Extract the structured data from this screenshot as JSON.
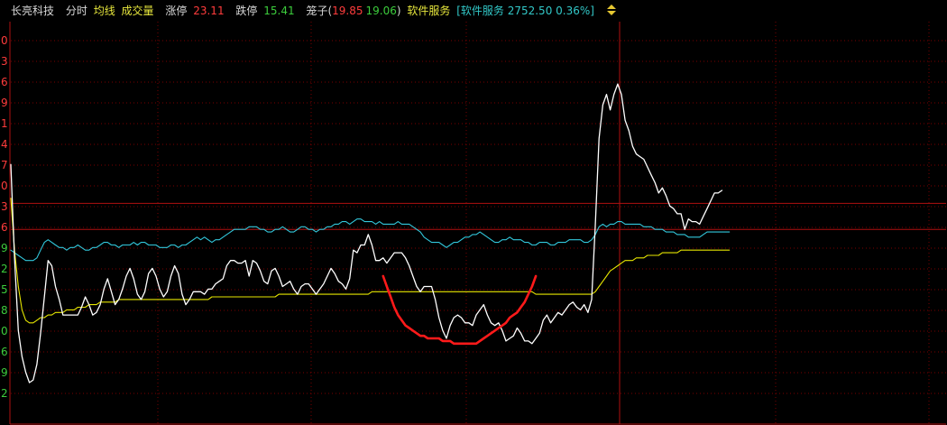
{
  "header": {
    "stock_name": "长亮科技",
    "mode_intraday": "分时",
    "mode_avg": "均线",
    "mode_volume": "成交量",
    "limit_up_label": "涨停",
    "limit_up_value": "23.11",
    "limit_down_label": "跌停",
    "limit_down_value": "15.41",
    "cage_label": "笼子(",
    "cage_high": "19.85",
    "cage_low": "19.06",
    "cage_close": ")",
    "sector": "软件服务",
    "index_text": "[软件服务 2752.50 0.36%]",
    "arrow_icon": "up-down-arrow-icon"
  },
  "colors": {
    "background": "#000000",
    "grid": "#7a0000",
    "stock_name": "#d8d8d8",
    "intraday": "#d8d8d8",
    "avg_label": "#e6e63c",
    "volume_label": "#e6e63c",
    "up": "#ff3c3c",
    "down": "#3ccc3c",
    "sector": "#e6e63c",
    "index": "#32c8c8",
    "price_line": "#ffffff",
    "avg_line": "#e6e600",
    "index_line": "#32c8dc",
    "marker_curve": "#ff1a1a",
    "arrow": "#e6c832"
  },
  "chart_data": {
    "type": "line",
    "y_axis_ticks": [
      "0",
      "3",
      "6",
      "9",
      "1",
      "4",
      "7",
      "0",
      "3",
      "6",
      "9",
      "2",
      "5",
      "8",
      "0",
      "6",
      "9",
      "2"
    ],
    "y_tick_colors": [
      "up",
      "up",
      "up",
      "up",
      "up",
      "up",
      "up",
      "up",
      "up",
      "up",
      "down",
      "down",
      "down",
      "down",
      "down",
      "down",
      "down",
      "down"
    ],
    "series": [
      {
        "key": "price",
        "values": [
          0.45,
          0.09,
          -0.19,
          -0.29,
          -0.35,
          -0.39,
          -0.38,
          -0.32,
          -0.2,
          -0.06,
          0.08,
          0.06,
          -0.02,
          -0.07,
          -0.13,
          -0.13,
          -0.13,
          -0.13,
          -0.13,
          -0.1,
          -0.06,
          -0.09,
          -0.13,
          -0.12,
          -0.09,
          -0.03,
          0.01,
          -0.04,
          -0.09,
          -0.07,
          -0.03,
          0.02,
          0.05,
          0.01,
          -0.05,
          -0.07,
          -0.04,
          0.03,
          0.05,
          0.02,
          -0.03,
          -0.06,
          -0.04,
          0.02,
          0.06,
          0.03,
          -0.05,
          -0.09,
          -0.07,
          -0.04,
          -0.04,
          -0.04,
          -0.05,
          -0.03,
          -0.03,
          -0.01,
          0.0,
          0.01,
          0.06,
          0.08,
          0.08,
          0.07,
          0.07,
          0.08,
          0.02,
          0.08,
          0.07,
          0.04,
          0.0,
          -0.01,
          0.04,
          0.05,
          0.02,
          -0.02,
          -0.01,
          0.0,
          -0.03,
          -0.05,
          -0.02,
          -0.01,
          -0.01,
          -0.03,
          -0.05,
          -0.03,
          -0.01,
          0.02,
          0.05,
          0.03,
          0.0,
          -0.01,
          -0.03,
          0.01,
          0.12,
          0.11,
          0.14,
          0.14,
          0.18,
          0.14,
          0.08,
          0.08,
          0.09,
          0.07,
          0.09,
          0.11,
          0.11,
          0.11,
          0.09,
          0.06,
          0.02,
          -0.02,
          -0.04,
          -0.02,
          -0.02,
          -0.02,
          -0.07,
          -0.14,
          -0.19,
          -0.22,
          -0.17,
          -0.14,
          -0.13,
          -0.14,
          -0.16,
          -0.16,
          -0.17,
          -0.13,
          -0.11,
          -0.09,
          -0.13,
          -0.16,
          -0.17,
          -0.16,
          -0.19,
          -0.23,
          -0.22,
          -0.21,
          -0.18,
          -0.2,
          -0.23,
          -0.23,
          -0.24,
          -0.22,
          -0.2,
          -0.15,
          -0.13,
          -0.16,
          -0.14,
          -0.12,
          -0.13,
          -0.11,
          -0.09,
          -0.08,
          -0.1,
          -0.11,
          -0.09,
          -0.12,
          -0.07,
          0.22,
          0.55,
          0.68,
          0.72,
          0.66,
          0.72,
          0.76,
          0.72,
          0.62,
          0.58,
          0.52,
          0.49,
          0.48,
          0.47,
          0.44,
          0.41,
          0.38,
          0.34,
          0.36,
          0.33,
          0.29,
          0.28,
          0.26,
          0.26,
          0.2,
          0.24,
          0.23,
          0.23,
          0.22,
          0.25,
          0.28,
          0.31,
          0.34,
          0.34,
          0.35
        ],
        "color_key": "price_line"
      },
      {
        "key": "average",
        "values": [
          0.32,
          0.12,
          -0.02,
          -0.11,
          -0.15,
          -0.16,
          -0.16,
          -0.15,
          -0.14,
          -0.14,
          -0.13,
          -0.13,
          -0.12,
          -0.12,
          -0.12,
          -0.11,
          -0.11,
          -0.11,
          -0.1,
          -0.1,
          -0.1,
          -0.09,
          -0.09,
          -0.09,
          -0.08,
          -0.08,
          -0.08,
          -0.08,
          -0.08,
          -0.07,
          -0.07,
          -0.07,
          -0.07,
          -0.07,
          -0.07,
          -0.07,
          -0.07,
          -0.07,
          -0.07,
          -0.07,
          -0.07,
          -0.07,
          -0.07,
          -0.07,
          -0.07,
          -0.07,
          -0.07,
          -0.07,
          -0.07,
          -0.07,
          -0.07,
          -0.07,
          -0.07,
          -0.07,
          -0.06,
          -0.06,
          -0.06,
          -0.06,
          -0.06,
          -0.06,
          -0.06,
          -0.06,
          -0.06,
          -0.06,
          -0.06,
          -0.06,
          -0.06,
          -0.06,
          -0.06,
          -0.06,
          -0.06,
          -0.06,
          -0.05,
          -0.05,
          -0.05,
          -0.05,
          -0.05,
          -0.05,
          -0.05,
          -0.05,
          -0.05,
          -0.05,
          -0.05,
          -0.05,
          -0.05,
          -0.05,
          -0.05,
          -0.05,
          -0.05,
          -0.05,
          -0.05,
          -0.05,
          -0.05,
          -0.05,
          -0.05,
          -0.05,
          -0.05,
          -0.04,
          -0.04,
          -0.04,
          -0.04,
          -0.04,
          -0.04,
          -0.04,
          -0.04,
          -0.04,
          -0.04,
          -0.04,
          -0.04,
          -0.04,
          -0.04,
          -0.04,
          -0.04,
          -0.04,
          -0.04,
          -0.04,
          -0.04,
          -0.04,
          -0.04,
          -0.04,
          -0.04,
          -0.04,
          -0.04,
          -0.04,
          -0.04,
          -0.04,
          -0.04,
          -0.04,
          -0.04,
          -0.04,
          -0.04,
          -0.04,
          -0.04,
          -0.04,
          -0.04,
          -0.04,
          -0.04,
          -0.04,
          -0.04,
          -0.04,
          -0.04,
          -0.05,
          -0.05,
          -0.05,
          -0.05,
          -0.05,
          -0.05,
          -0.05,
          -0.05,
          -0.05,
          -0.05,
          -0.05,
          -0.05,
          -0.05,
          -0.05,
          -0.05,
          -0.05,
          -0.04,
          -0.02,
          0.0,
          0.02,
          0.04,
          0.05,
          0.06,
          0.07,
          0.08,
          0.08,
          0.08,
          0.09,
          0.09,
          0.09,
          0.1,
          0.1,
          0.1,
          0.1,
          0.11,
          0.11,
          0.11,
          0.11,
          0.11,
          0.12,
          0.12,
          0.12,
          0.12,
          0.12,
          0.12,
          0.12,
          0.12,
          0.12,
          0.12,
          0.12,
          0.12,
          0.12,
          0.12
        ],
        "color_key": "avg_line"
      },
      {
        "key": "index",
        "values": [
          0.12,
          0.11,
          0.1,
          0.09,
          0.08,
          0.08,
          0.08,
          0.09,
          0.12,
          0.15,
          0.16,
          0.15,
          0.14,
          0.13,
          0.13,
          0.12,
          0.13,
          0.13,
          0.14,
          0.13,
          0.12,
          0.12,
          0.13,
          0.13,
          0.14,
          0.15,
          0.15,
          0.14,
          0.14,
          0.13,
          0.14,
          0.14,
          0.14,
          0.15,
          0.14,
          0.15,
          0.15,
          0.14,
          0.14,
          0.14,
          0.13,
          0.13,
          0.13,
          0.14,
          0.14,
          0.13,
          0.14,
          0.14,
          0.15,
          0.16,
          0.17,
          0.16,
          0.17,
          0.16,
          0.15,
          0.16,
          0.16,
          0.17,
          0.18,
          0.19,
          0.2,
          0.2,
          0.2,
          0.2,
          0.21,
          0.21,
          0.21,
          0.2,
          0.2,
          0.19,
          0.19,
          0.2,
          0.2,
          0.21,
          0.2,
          0.19,
          0.19,
          0.2,
          0.21,
          0.21,
          0.2,
          0.2,
          0.19,
          0.2,
          0.2,
          0.21,
          0.21,
          0.22,
          0.22,
          0.23,
          0.23,
          0.22,
          0.23,
          0.24,
          0.24,
          0.23,
          0.23,
          0.23,
          0.22,
          0.23,
          0.22,
          0.22,
          0.22,
          0.22,
          0.23,
          0.22,
          0.22,
          0.22,
          0.21,
          0.2,
          0.19,
          0.17,
          0.16,
          0.15,
          0.15,
          0.15,
          0.14,
          0.13,
          0.14,
          0.15,
          0.15,
          0.16,
          0.17,
          0.17,
          0.18,
          0.18,
          0.19,
          0.18,
          0.17,
          0.16,
          0.15,
          0.15,
          0.16,
          0.16,
          0.17,
          0.16,
          0.16,
          0.16,
          0.15,
          0.15,
          0.14,
          0.14,
          0.15,
          0.15,
          0.15,
          0.14,
          0.14,
          0.15,
          0.15,
          0.15,
          0.16,
          0.16,
          0.16,
          0.16,
          0.15,
          0.15,
          0.16,
          0.18,
          0.21,
          0.22,
          0.21,
          0.22,
          0.22,
          0.23,
          0.23,
          0.22,
          0.22,
          0.22,
          0.22,
          0.22,
          0.21,
          0.21,
          0.21,
          0.2,
          0.2,
          0.2,
          0.19,
          0.19,
          0.19,
          0.18,
          0.18,
          0.18,
          0.17,
          0.17,
          0.17,
          0.17,
          0.18,
          0.19,
          0.19,
          0.19,
          0.19,
          0.19,
          0.19,
          0.19
        ],
        "color_key": "index_line"
      },
      {
        "key": "marker_curve",
        "start_index": 100,
        "values": [
          0.02,
          -0.02,
          -0.06,
          -0.1,
          -0.13,
          -0.15,
          -0.17,
          -0.18,
          -0.19,
          -0.2,
          -0.21,
          -0.21,
          -0.22,
          -0.22,
          -0.22,
          -0.22,
          -0.23,
          -0.23,
          -0.23,
          -0.24,
          -0.24,
          -0.24,
          -0.24,
          -0.24,
          -0.24,
          -0.24,
          -0.23,
          -0.22,
          -0.21,
          -0.2,
          -0.19,
          -0.18,
          -0.17,
          -0.16,
          -0.14,
          -0.13,
          -0.12,
          -0.1,
          -0.08,
          -0.05,
          -0.02,
          0.02
        ],
        "color_key": "marker_curve"
      }
    ],
    "y_range": [
      -0.55,
      1.0
    ],
    "x_count": 204,
    "reference_lines": [
      0.3,
      0.2
    ]
  }
}
